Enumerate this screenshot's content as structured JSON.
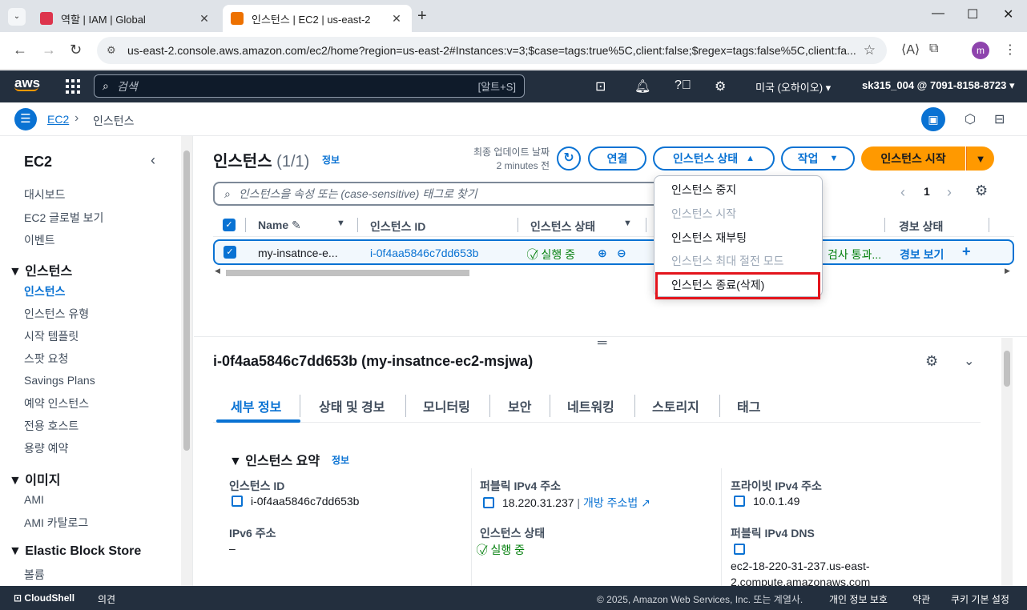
{
  "browser": {
    "tabs": [
      {
        "title": "역할 | IAM | Global",
        "favicon_color": "#dd344c"
      },
      {
        "title": "인스턴스 | EC2 | us-east-2",
        "favicon_color": "#ed7100"
      }
    ],
    "url": "us-east-2.console.aws.amazon.com/ec2/home?region=us-east-2#Instances:v=3;$case=tags:true%5C,client:false;$regex=tags:false%5C,client:fa...",
    "profile_letter": "m"
  },
  "awsnav": {
    "logo": "aws",
    "search_placeholder": "검색",
    "search_shortcut": "[알트+S]",
    "region": "미국 (오하이오) ▾",
    "account": "sk315_004 @ 7091-8158-8723 ▾"
  },
  "breadcrumb": {
    "service": "EC2",
    "separator": "›",
    "current": "인스턴스"
  },
  "sidebar": {
    "title": "EC2",
    "items_top": [
      "대시보드",
      "EC2 글로벌 보기",
      "이벤트"
    ],
    "sections": [
      {
        "label": "▼ 인스턴스",
        "items": [
          "인스턴스",
          "인스턴스 유형",
          "시작 템플릿",
          "스팟 요청",
          "Savings Plans",
          "예약 인스턴스",
          "전용 호스트",
          "용량 예약"
        ]
      },
      {
        "label": "▼ 이미지",
        "items": [
          "AMI",
          "AMI 카탈로그"
        ]
      },
      {
        "label": "▼ Elastic Block Store",
        "items": [
          "볼륨"
        ]
      }
    ]
  },
  "header": {
    "title": "인스턴스",
    "count": "(1/1)",
    "info": "정보",
    "updated_label": "최종 업데이트 날짜",
    "updated_value": "2 minutes 전",
    "connect": "연결",
    "state_menu": "인스턴스 상태",
    "actions": "작업",
    "launch": "인스턴스 시작"
  },
  "filter": {
    "placeholder": "인스턴스을 속성 또는 (case-sensitive) 태그로 찾기"
  },
  "pagination": {
    "prev": "‹",
    "page": "1",
    "next": "›"
  },
  "table": {
    "columns": [
      "Name",
      "인스턴스 ID",
      "인스턴스 상태",
      "경보 상태"
    ],
    "row": {
      "name": "my-insatnce-e...",
      "id": "i-0f4aa5846c7dd653b",
      "state": "실행 중",
      "status_check": "검사 통과...",
      "alarm": "경보 보기"
    }
  },
  "dropdown": {
    "items": [
      {
        "label": "인스턴스 중지",
        "enabled": true
      },
      {
        "label": "인스턴스 시작",
        "enabled": false
      },
      {
        "label": "인스턴스 재부팅",
        "enabled": true
      },
      {
        "label": "인스턴스 최대 절전 모드",
        "enabled": false
      },
      {
        "label": "인스턴스 종료(삭제)",
        "enabled": true
      }
    ]
  },
  "detail": {
    "title": "i-0f4aa5846c7dd653b (my-insatnce-ec2-msjwa)",
    "tabs": [
      "세부 정보",
      "상태 및 경보",
      "모니터링",
      "보안",
      "네트워킹",
      "스토리지",
      "태그"
    ],
    "summary_title": "▼ 인스턴스 요약",
    "summary_info": "정보",
    "fields": {
      "instance_id_label": "인스턴스 ID",
      "instance_id": "i-0f4aa5846c7dd653b",
      "public_ipv4_label": "퍼블릭 IPv4 주소",
      "public_ipv4": "18.220.31.237",
      "open_address": "개방 주소법",
      "private_ipv4_label": "프라이빗 IPv4 주소",
      "private_ipv4": "10.0.1.49",
      "ipv6_label": "IPv6 주소",
      "ipv6": "–",
      "state_label": "인스턴스 상태",
      "state": "실행 중",
      "public_dns_label": "퍼블릭 IPv4 DNS",
      "public_dns_line1": "ec2-18-220-31-237.us-east-",
      "public_dns_line2": "2.compute.amazonaws.com"
    }
  },
  "footer": {
    "cloudshell": "CloudShell",
    "feedback": "의견",
    "copyright": "© 2025, Amazon Web Services, Inc. 또는 계열사.",
    "privacy": "개인 정보 보호",
    "terms": "약관",
    "cookie": "쿠키 기본 설정"
  },
  "colors": {
    "accent": "#0972d3",
    "orange": "#ff9900",
    "nav": "#232f3e",
    "success": "#037f0c",
    "highlight": "#e3141c"
  }
}
